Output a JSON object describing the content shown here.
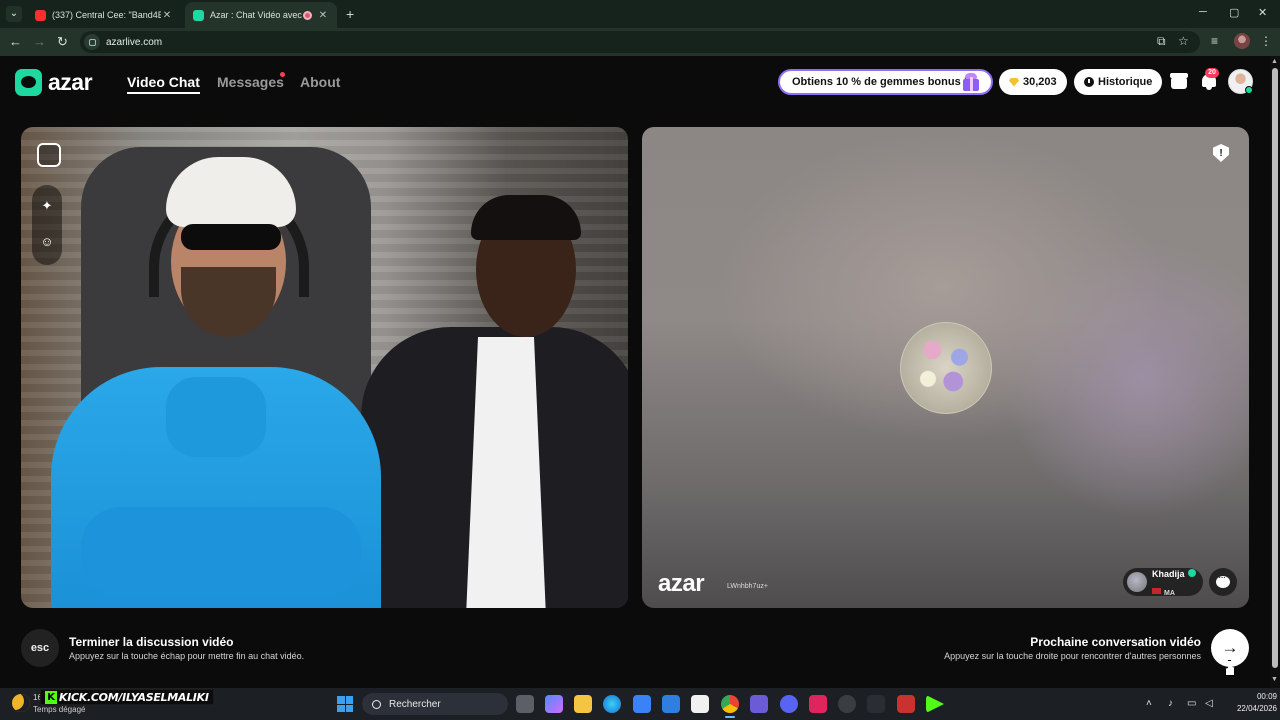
{
  "browser": {
    "tabs": [
      {
        "title": "(337) Central Cee: \"Band4Band\"",
        "close": "✕"
      },
      {
        "title": "Azar : Chat Vidéo avec de nouveaux",
        "close": "✕"
      }
    ],
    "new_tab": "+",
    "url": "azarlive.com",
    "window_controls": {
      "minimize": "─",
      "maximize": "▢",
      "close": "✕"
    }
  },
  "header": {
    "logo": "azar",
    "nav": [
      {
        "label": "Video Chat",
        "active": true
      },
      {
        "label": "Messages",
        "active": false
      },
      {
        "label": "About",
        "active": false
      }
    ],
    "promo": "Obtiens 10 % de gemmes bonus !",
    "gems": "30,203",
    "history": "Historique",
    "notif_count": "20"
  },
  "peer": {
    "watermark": "azar",
    "watermark_id": "LWnhbh7uz+",
    "name": "Khadija",
    "country": "MA"
  },
  "hints": {
    "esc_key": "esc",
    "end_title": "Terminer la discussion vidéo",
    "end_sub": "Appuyez sur la touche échap pour mettre fin au chat vidéo.",
    "next_title": "Prochaine conversation vidéo",
    "next_sub": "Appuyez sur la touche droite pour rencontrer d'autres personnes",
    "next_arrow": "→"
  },
  "taskbar": {
    "temp": "16",
    "weather": "Temps dégagé",
    "overlay": "KICK.COM/ILYASELMALIKI",
    "search": "Rechercher",
    "time": "00:09",
    "date": "22/04/2026"
  },
  "colors": {
    "accent": "#1dd9a0",
    "promo_border": "#8f6df5",
    "notif": "#ff3b5c"
  }
}
